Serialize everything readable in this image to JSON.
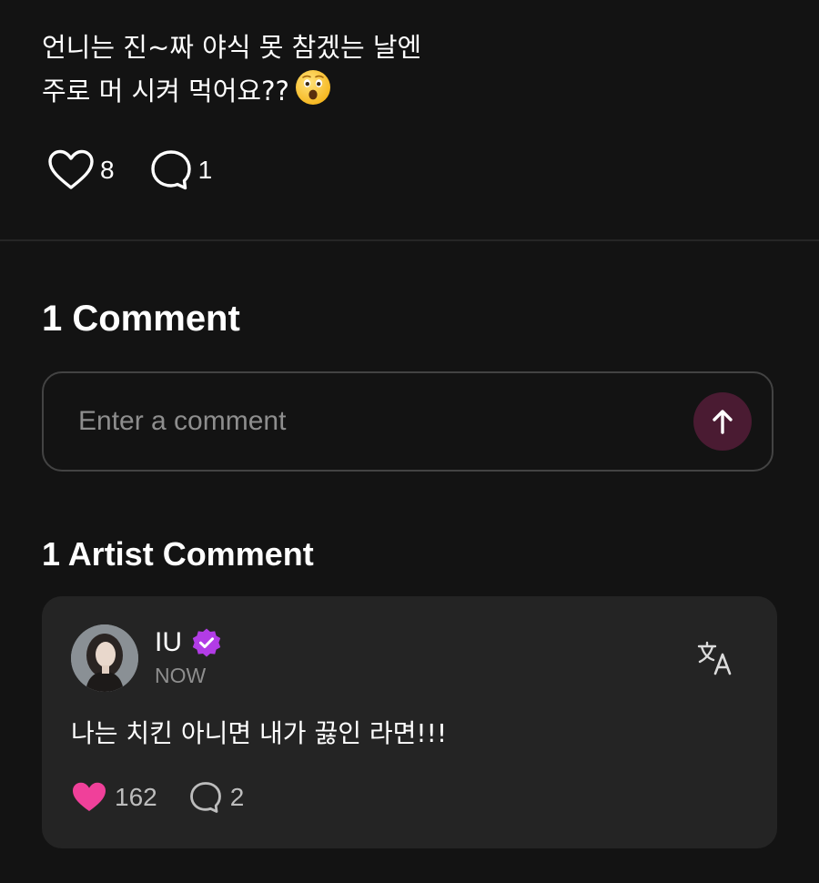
{
  "post": {
    "text_line1": "언니는 진~짜 야식 못 참겠는 날엔",
    "text_line2": "주로 머 시켜 먹어요??",
    "emoji": "astonished-face-emoji",
    "like_count": "8",
    "comment_count": "1"
  },
  "comments_section": {
    "title": "1 Comment",
    "input": {
      "value": "",
      "placeholder": "Enter a comment"
    },
    "send_icon": "arrow-up-icon"
  },
  "artist_section": {
    "title": "1 Artist Comment",
    "comment": {
      "author": "IU",
      "verified_icon": "verified-badge-icon",
      "time": "NOW",
      "translate_icon": "translate-icon",
      "text": "나는 치킨 아니면 내가 끓인 라면!!!",
      "like_count": "162",
      "reply_count": "2"
    }
  },
  "colors": {
    "background": "#131313",
    "card": "#242424",
    "accent_pink": "#f0409a",
    "verified_purple": "#b23ce6",
    "send_button": "#4a1b32",
    "muted_text": "#8e8e8e"
  }
}
